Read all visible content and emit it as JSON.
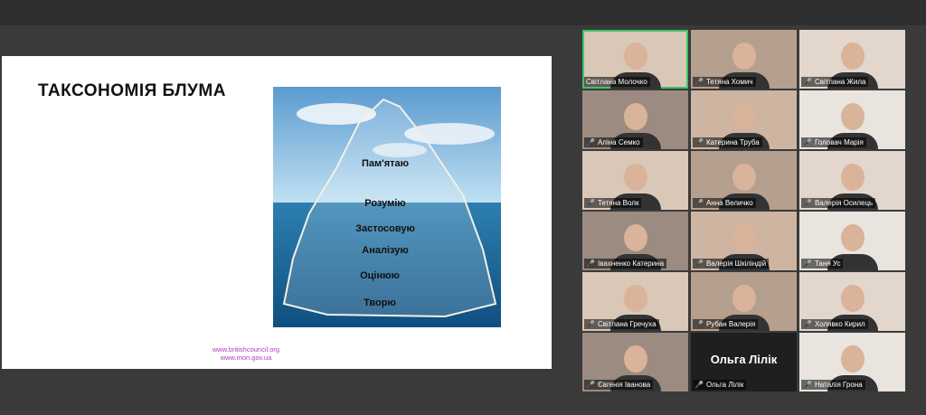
{
  "slide": {
    "title": "ТАКСОНОМІЯ БЛУМА",
    "levels": [
      "Пам'ятаю",
      "Розумію",
      "Застосовую",
      "Аналізую",
      "Оцінюю",
      "Творю"
    ],
    "links": [
      "www.britishcouncil.org",
      "www.mon.gov.ua"
    ]
  },
  "participants": [
    {
      "name": "Світлана Молочко",
      "active": true,
      "muted": false
    },
    {
      "name": "Тетяна Хомич",
      "muted": true
    },
    {
      "name": "Світлана Жила",
      "muted": true
    },
    {
      "name": "Аліна Семко",
      "muted": true
    },
    {
      "name": "Катерина Труба",
      "muted": true
    },
    {
      "name": "Головач Марія",
      "muted": true
    },
    {
      "name": "Тетяна Волк",
      "muted": true
    },
    {
      "name": "Анна Величко",
      "muted": true
    },
    {
      "name": "Валерія Осилець",
      "muted": true
    },
    {
      "name": "Івахненко Катерина",
      "muted": true
    },
    {
      "name": "Валерія Шкіліндій",
      "muted": true
    },
    {
      "name": "Таня Ус",
      "muted": true
    },
    {
      "name": "Світлана Гречуха",
      "muted": true
    },
    {
      "name": "Рубан Валерія",
      "muted": true
    },
    {
      "name": "Холявко Кирил",
      "muted": true
    },
    {
      "name": "Євгенія Іванова",
      "muted": true
    },
    {
      "name": "Ольга Лілік",
      "muted": true,
      "video_off": true
    },
    {
      "name": "Наталія Грона",
      "muted": true
    }
  ],
  "icons": {
    "muted": "mic-muted-icon"
  }
}
